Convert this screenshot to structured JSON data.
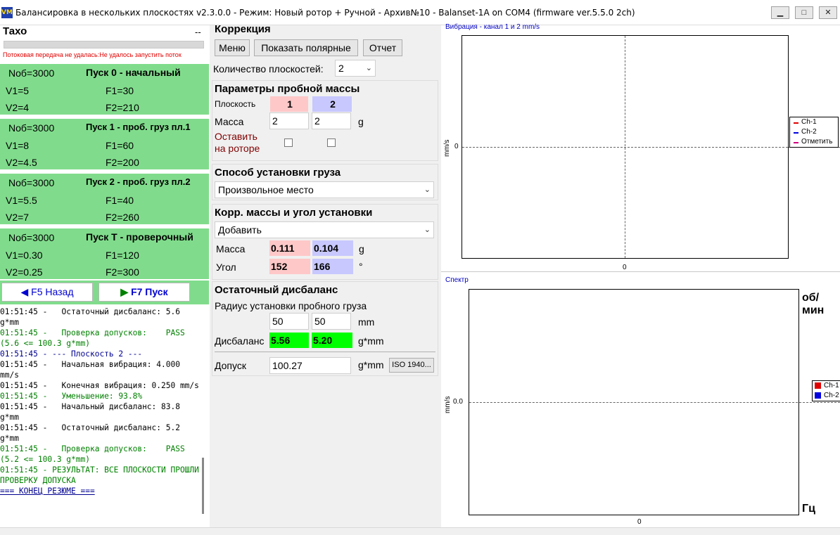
{
  "window": {
    "title": "Балансировка в нескольких плоскостях v2.3.0.0 - Режим: Новый ротор + Ручной - Архив№10 - Balanset-1A on COM4 (firmware ver.5.5.0 2ch)",
    "icon": "app-logo-icon",
    "controls": [
      "minimize-icon",
      "maximize-icon",
      "close-icon"
    ]
  },
  "taxo": {
    "title": "Тахо",
    "value": "--",
    "error": "Потоковая передача не удалась:Не удалось запустить поток"
  },
  "runs": [
    {
      "nob": "Nоб=3000",
      "title": "Пуск 0 - начальный",
      "v1": "V1=5",
      "f1": "F1=30",
      "v2": "V2=4",
      "f2": "F2=210"
    },
    {
      "nob": "Nоб=3000",
      "title": "Пуск 1 - проб. груз пл.1",
      "v1": "V1=8",
      "f1": "F1=60",
      "v2": "V2=4.5",
      "f2": "F2=200"
    },
    {
      "nob": "Nоб=3000",
      "title": "Пуск 2 - проб. груз пл.2",
      "v1": "V1=5.5",
      "f1": "F1=40",
      "v2": "V2=7",
      "f2": "F2=260"
    },
    {
      "nob": "Nоб=3000",
      "title": "Пуск Т - проверочный",
      "v1": "V1=0.30",
      "f1": "F1=120",
      "v2": "V2=0.25",
      "f2": "F2=300"
    }
  ],
  "nav": {
    "back_label": "F5 Назад",
    "run_label": "F7 Пуск",
    "back_icon": "triangle-left-icon",
    "run_icon": "triangle-right-icon"
  },
  "log": [
    {
      "c": "k",
      "t": "01:51:45 -   Остаточный дисбаланс: 5.6 g*mm"
    },
    {
      "c": "g",
      "t": "01:51:45 -   Проверка допусков:    PASS (5.6 <= 100.3 g*mm)"
    },
    {
      "c": "b",
      "t": "01:51:45 - --- Плоскость 2 ---"
    },
    {
      "c": "k",
      "t": "01:51:45 -   Начальная вибрация: 4.000 mm/s"
    },
    {
      "c": "k",
      "t": "01:51:45 -   Конечная вибрация: 0.250 mm/s"
    },
    {
      "c": "g",
      "t": "01:51:45 -   Уменьшение: 93.8%"
    },
    {
      "c": "k",
      "t": "01:51:45 -   Начальный дисбаланс: 83.8 g*mm"
    },
    {
      "c": "k",
      "t": "01:51:45 -   Остаточный дисбаланс: 5.2 g*mm"
    },
    {
      "c": "g",
      "t": "01:51:45 -   Проверка допусков:    PASS (5.2 <= 100.3 g*mm)"
    },
    {
      "c": "g",
      "t": "01:51:45 - РЕЗУЛЬТАТ: ВСЕ ПЛОСКОСТИ ПРОШЛИ ПРОВЕРКУ ДОПУСКА"
    },
    {
      "c": "end",
      "t": "=== КОНЕЦ РЕЗЮМЕ ==="
    }
  ],
  "correction": {
    "title": "Коррекция",
    "menu_label": "Меню",
    "polar_label": "Показать полярные",
    "report_label": "Отчет",
    "planes_label": "Количество плоскостей:",
    "planes_value": "2"
  },
  "trial": {
    "title": "Параметры пробной массы",
    "plane_label": "Плоскость",
    "plane1": "1",
    "plane2": "2",
    "mass_label": "Масса",
    "mass1": "2",
    "mass2": "2",
    "mass_unit": "g",
    "leave_label_1": "Оставить",
    "leave_label_2": "на роторе"
  },
  "install": {
    "title": "Способ установки груза",
    "method": "Произвольное место"
  },
  "corr": {
    "title": "Корр. массы и угол установки",
    "mode": "Добавить",
    "mass_label": "Масса",
    "mass1": "0.111",
    "mass2": "0.104",
    "mass_unit": "g",
    "angle_label": "Угол",
    "angle1": "152",
    "angle2": "166",
    "angle_unit": "°"
  },
  "residual": {
    "title": "Остаточный дисбаланс",
    "radius_label": "Радиус установки пробного груза",
    "radius1": "50",
    "radius2": "50",
    "radius_unit": "mm",
    "imb_label": "Дисбаланс",
    "imb1": "5.56",
    "imb2": "5.20",
    "imb_unit": "g*mm",
    "tol_label": "Допуск",
    "tol_value": "100.27",
    "tol_unit": "g*mm",
    "iso_label": "ISO 1940..."
  },
  "colors": {
    "run_bg": "#80dc8c",
    "plane1": "#ffc8c8",
    "plane2": "#c8c8ff",
    "pass_green": "#00ff00",
    "ch1": "#e00000",
    "ch2": "#0000e0",
    "mark": "#d00080"
  },
  "chart_data": [
    {
      "type": "line",
      "title": "Вибрация - канал 1 и 2 mm/s",
      "ylabel": "mm/s",
      "ytick": "0",
      "xtick": "0",
      "series": [
        {
          "name": "Ch-1",
          "values": []
        },
        {
          "name": "Ch-2",
          "values": []
        },
        {
          "name": "Отметить",
          "values": []
        }
      ],
      "grid": true,
      "legend": "right"
    },
    {
      "type": "bar",
      "title": "Спектр",
      "ylabel": "mm/s",
      "ytick": "0.0",
      "xtick": "0",
      "unit_top": "об/мин",
      "unit_bottom": "Гц",
      "series": [
        {
          "name": "Ch-1",
          "values": []
        },
        {
          "name": "Ch-2",
          "values": []
        }
      ],
      "grid": true,
      "legend": "right"
    }
  ]
}
